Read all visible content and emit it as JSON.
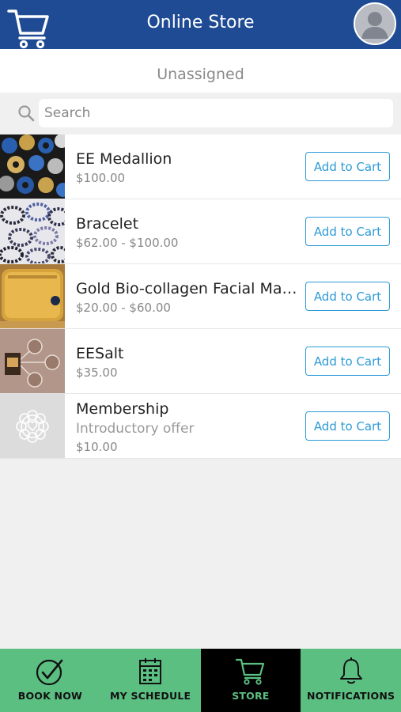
{
  "header": {
    "title": "Online Store",
    "cart_icon": "cart-icon",
    "avatar_icon": "user-avatar-icon"
  },
  "subheader": {
    "label": "Unassigned"
  },
  "search": {
    "placeholder": "Search",
    "value": "",
    "icon": "search-icon"
  },
  "products": [
    {
      "name": "EE Medallion",
      "price": "$100.00",
      "button": "Add to Cart"
    },
    {
      "name": "Bracelet",
      "price": "$62.00 - $100.00",
      "button": "Add to Cart"
    },
    {
      "name": "Gold Bio-collagen Facial Mas…",
      "price": "$20.00 - $60.00",
      "button": "Add to Cart"
    },
    {
      "name": "EESalt",
      "price": "$35.00",
      "button": "Add to Cart"
    },
    {
      "name": "Membership",
      "description": "Introductory offer",
      "price": "$10.00",
      "button": "Add to Cart"
    }
  ],
  "tabs": [
    {
      "label": "BOOK NOW",
      "icon": "check-circle-icon"
    },
    {
      "label": "MY SCHEDULE",
      "icon": "calendar-icon"
    },
    {
      "label": "STORE",
      "icon": "cart-icon",
      "active": true
    },
    {
      "label": "NOTIFICATIONS",
      "icon": "bell-icon"
    }
  ],
  "colors": {
    "header": "#1f4b94",
    "accent": "#2d9bd6",
    "tabbar": "#5cbf82",
    "active_tab": "#000000"
  }
}
